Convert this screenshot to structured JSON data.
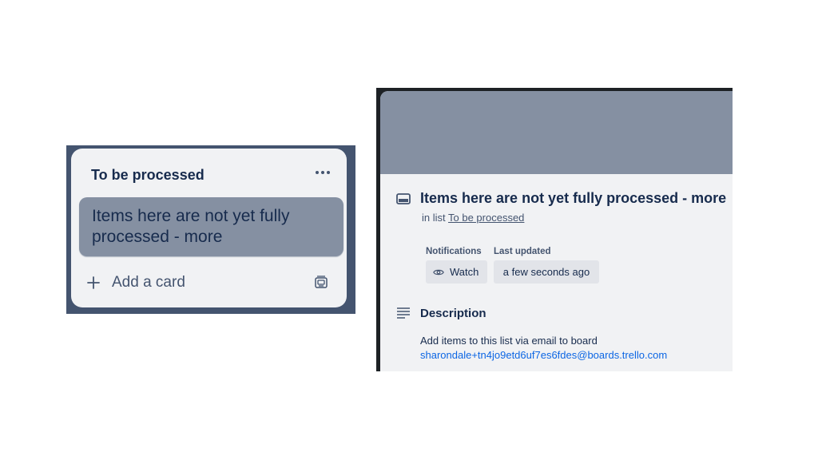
{
  "list": {
    "title": "To be processed",
    "menu_icon": "ellipsis-icon",
    "card_title": "Items here are not yet fully processed - more",
    "add_card_label": "Add a card",
    "add_icon": "plus-icon",
    "template_icon": "card-template-icon"
  },
  "detail": {
    "title": "Items here are not yet fully processed - more",
    "in_list_prefix": "in list",
    "in_list_link": "To be processed",
    "notifications_label": "Notifications",
    "watch_label": "Watch",
    "last_updated_label": "Last updated",
    "last_updated_value": "a few seconds ago",
    "description_heading": "Description",
    "description_text": "Add items to this list via email to board",
    "description_email": "sharondale+tn4jo9etd6uf7es6fdes@boards.trello.com"
  },
  "colors": {
    "cover": "#8590a2",
    "list_bg": "#f1f2f4",
    "link": "#0c66e4",
    "text": "#172b4d"
  }
}
